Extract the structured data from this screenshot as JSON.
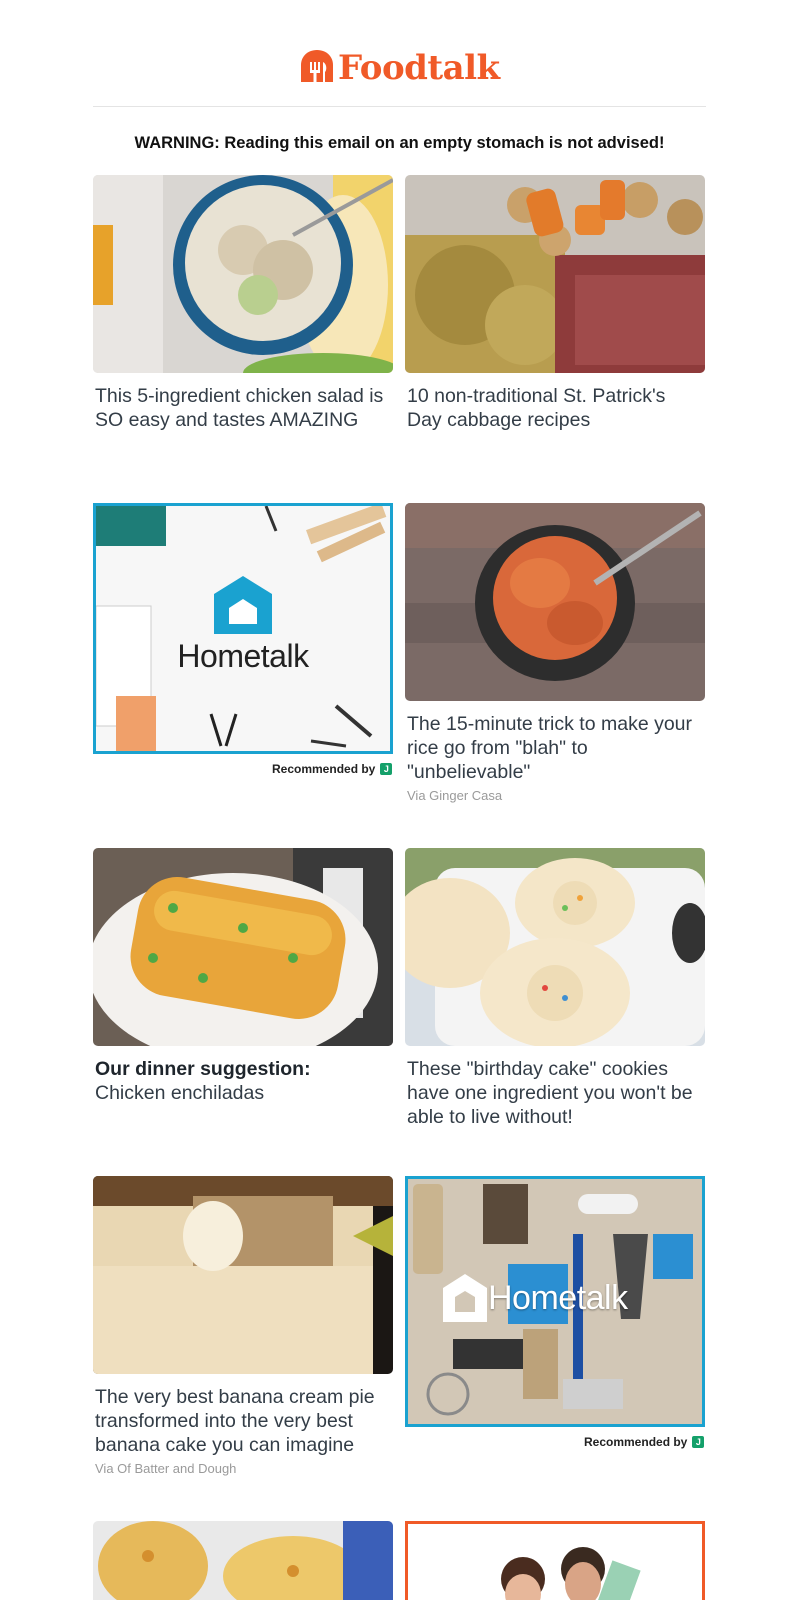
{
  "brand": {
    "name": "Foodtalk",
    "color": "#f05a28"
  },
  "warning": "WARNING: Reading this email on an empty stomach is not advised!",
  "articles": [
    {
      "title": "This 5-ingredient chicken salad is SO easy and tastes AMAZING"
    },
    {
      "title": "10 non-traditional St. Patrick's Day cabbage recipes"
    },
    {
      "title": "The 15-minute trick to make your rice go from \"blah\" to \"unbelievable\"",
      "via": "Via Ginger Casa"
    },
    {
      "prefix": "Our dinner suggestion:",
      "title": "Chicken enchiladas"
    },
    {
      "title": "These \"birthday cake\" cookies have one ingredient you won't be able to live without!"
    },
    {
      "title": "The very best banana cream pie transformed into the very best banana cake you can imagine",
      "via": "Via Of Batter and Dough"
    }
  ],
  "ads": [
    {
      "brand": "Hometalk",
      "recommended": "Recommended by"
    },
    {
      "brand": "Hometalk",
      "recommended": "Recommended by"
    }
  ],
  "colors": {
    "ad_border": "#1aa2d0",
    "accent": "#f05a28"
  }
}
